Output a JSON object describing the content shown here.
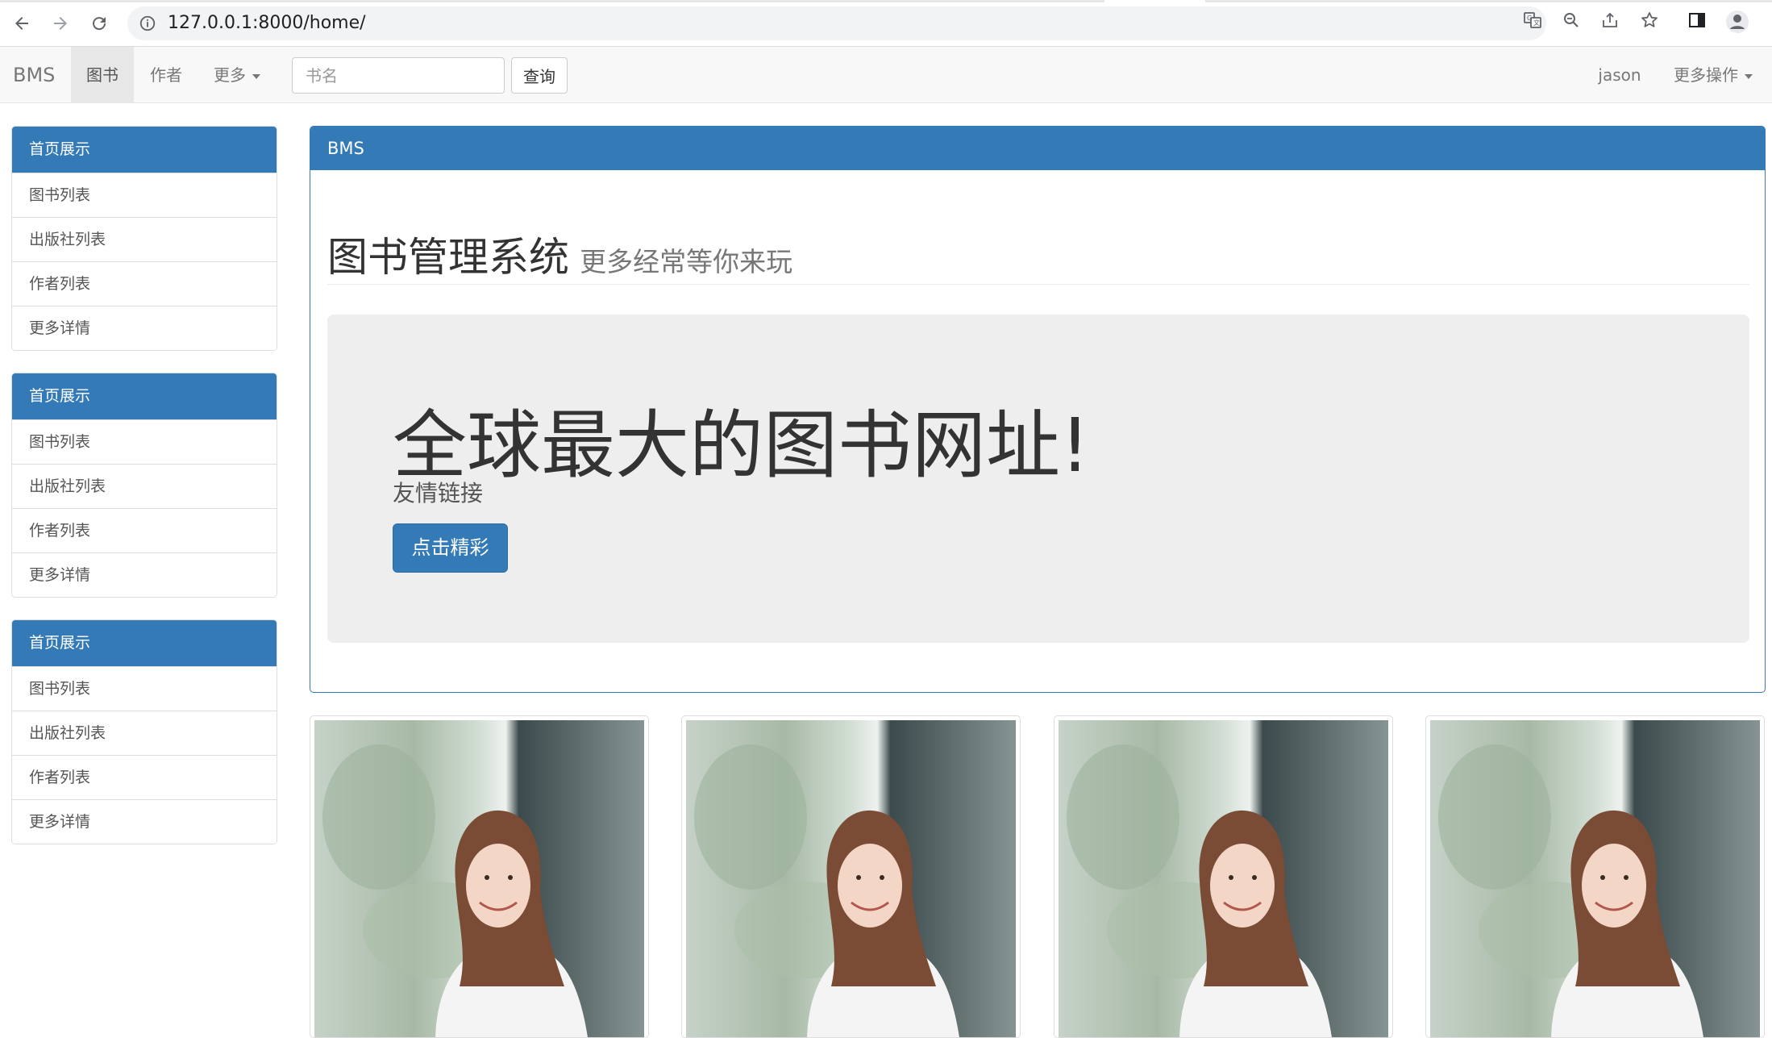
{
  "browser": {
    "url": "127.0.0.1:8000/home/",
    "icons": [
      "back-icon",
      "forward-icon",
      "reload-icon",
      "info-icon",
      "translate-icon",
      "zoom-icon",
      "share-icon",
      "star-icon",
      "sidepanel-icon",
      "profile-icon"
    ]
  },
  "navbar": {
    "brand": "BMS",
    "items": [
      {
        "label": "图书",
        "active": true
      },
      {
        "label": "作者",
        "active": false
      },
      {
        "label": "更多",
        "dropdown": true
      }
    ],
    "search": {
      "placeholder": "书名",
      "button": "查询"
    },
    "user": "jason",
    "more_ops": "更多操作"
  },
  "sidebar": {
    "groups": [
      {
        "title": "首页展示",
        "items": [
          "图书列表",
          "出版社列表",
          "作者列表",
          "更多详情"
        ]
      },
      {
        "title": "首页展示",
        "items": [
          "图书列表",
          "出版社列表",
          "作者列表",
          "更多详情"
        ]
      },
      {
        "title": "首页展示",
        "items": [
          "图书列表",
          "出版社列表",
          "作者列表",
          "更多详情"
        ]
      }
    ]
  },
  "panel": {
    "heading": "BMS",
    "page_title": "图书管理系统",
    "page_subtitle": "更多经常等你来玩",
    "jumbotron": {
      "headline": "全球最大的图书网址!",
      "lead": "友情链接",
      "button": "点击精彩"
    }
  },
  "thumbnails": {
    "count": 4
  },
  "colors": {
    "primary": "#337ab7",
    "navbar_bg": "#f8f8f8",
    "jumbotron_bg": "#eeeeee"
  }
}
